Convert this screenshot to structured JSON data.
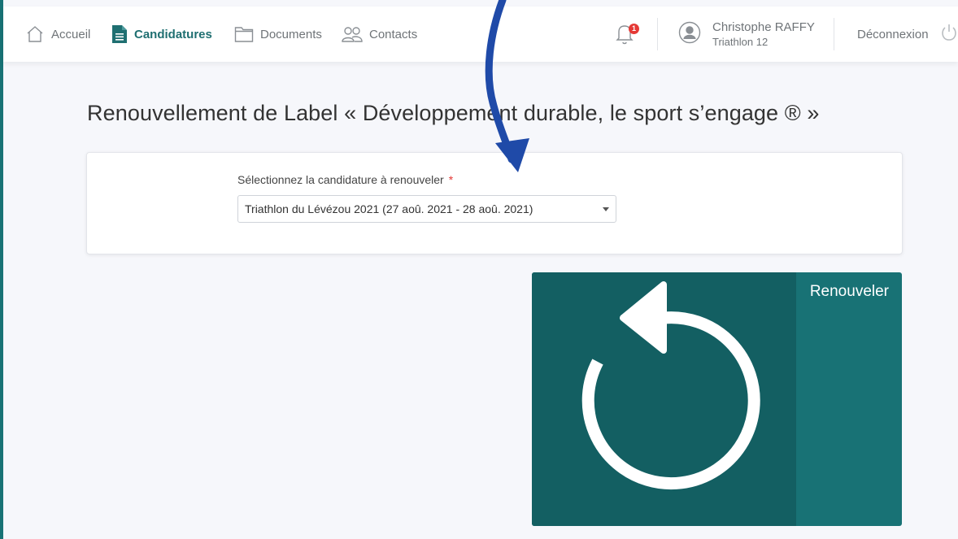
{
  "header": {
    "nav": [
      {
        "label": "Accueil",
        "icon": "home-icon"
      },
      {
        "label": "Candidatures",
        "icon": "document-icon",
        "active": true
      },
      {
        "label": "Documents",
        "icon": "folder-icon"
      },
      {
        "label": "Contacts",
        "icon": "users-icon"
      }
    ],
    "notifications": {
      "count": "1",
      "icon": "bell-icon"
    },
    "user": {
      "name": "Christophe RAFFY",
      "organization": "Triathlon 12",
      "icon": "user-avatar-icon"
    },
    "logout_label": "Déconnexion"
  },
  "page": {
    "title": "Renouvellement de Label « Développement durable, le sport s’engage ® »"
  },
  "form": {
    "label": "Sélectionnez la candidature à renouveler",
    "required_mark": "*",
    "selected_value": "Triathlon du Lévézou 2021 (27 aoû. 2021 - 28 aoû. 2021)"
  },
  "action_tile": {
    "label": "Renouveler",
    "icon": "refresh-icon"
  },
  "colors": {
    "brand_teal": "#187275",
    "brand_teal_dark": "#135f62",
    "badge_red": "#e53935",
    "annotation_blue": "#1f4aa8"
  }
}
